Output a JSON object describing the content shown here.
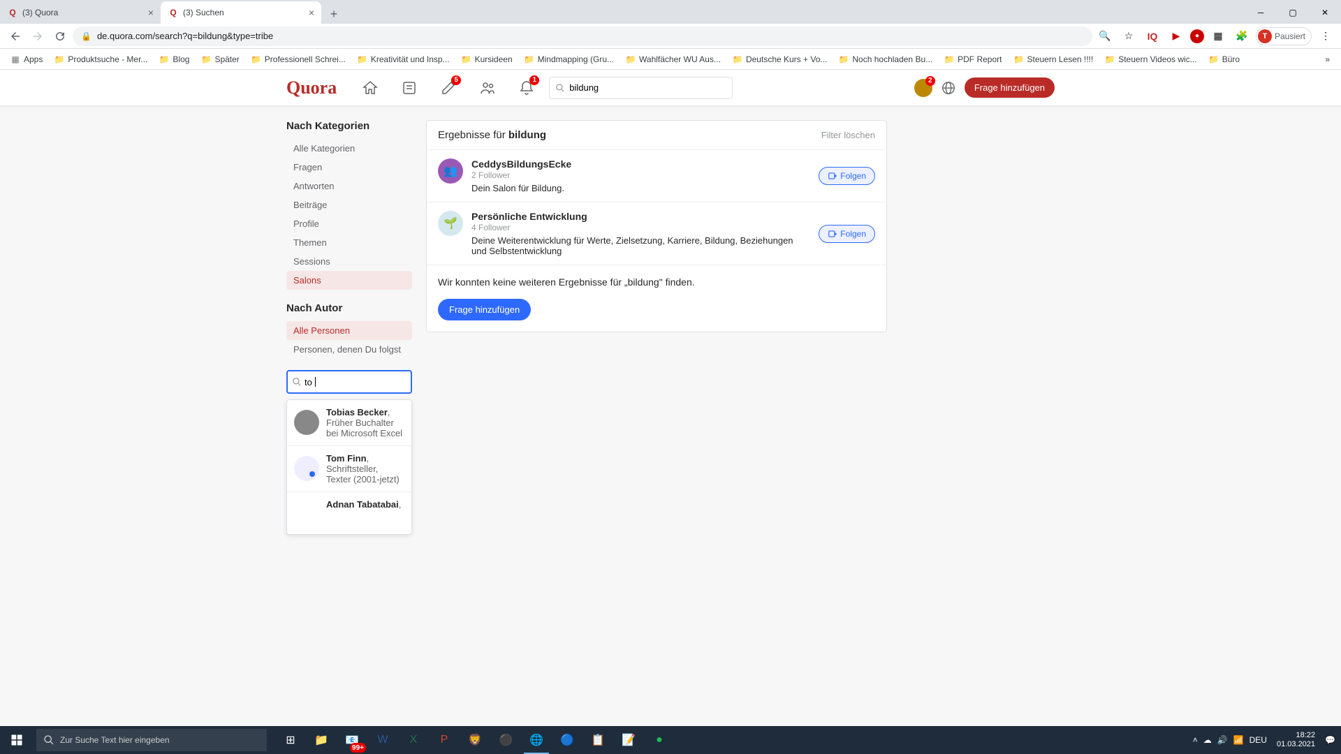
{
  "browser": {
    "tabs": [
      {
        "title": "(3) Quora",
        "active": false
      },
      {
        "title": "(3) Suchen",
        "active": true
      }
    ],
    "url": "de.quora.com/search?q=bildung&type=tribe",
    "profile_status": "Pausiert",
    "profile_initial": "T"
  },
  "bookmarks": [
    {
      "label": "Apps",
      "icon": "apps"
    },
    {
      "label": "Produktsuche - Mer...",
      "icon": "folder"
    },
    {
      "label": "Blog",
      "icon": "folder"
    },
    {
      "label": "Später",
      "icon": "folder"
    },
    {
      "label": "Professionell Schrei...",
      "icon": "folder"
    },
    {
      "label": "Kreativität und Insp...",
      "icon": "folder"
    },
    {
      "label": "Kursideen",
      "icon": "folder"
    },
    {
      "label": "Mindmapping (Gru...",
      "icon": "folder"
    },
    {
      "label": "Wahlfächer WU Aus...",
      "icon": "folder"
    },
    {
      "label": "Deutsche Kurs + Vo...",
      "icon": "folder"
    },
    {
      "label": "Noch hochladen Bu...",
      "icon": "folder"
    },
    {
      "label": "PDF Report",
      "icon": "folder"
    },
    {
      "label": "Steuern Lesen !!!!",
      "icon": "folder"
    },
    {
      "label": "Steuern Videos wic...",
      "icon": "folder"
    },
    {
      "label": "Büro",
      "icon": "folder"
    }
  ],
  "quora_header": {
    "logo": "Quora",
    "search_value": "bildung",
    "badges": {
      "edit": "5",
      "bell": "1",
      "profile": "2"
    },
    "add_question": "Frage hinzufügen"
  },
  "sidebar": {
    "categories_heading": "Nach Kategorien",
    "categories": [
      {
        "label": "Alle Kategorien",
        "active": false
      },
      {
        "label": "Fragen",
        "active": false
      },
      {
        "label": "Antworten",
        "active": false
      },
      {
        "label": "Beiträge",
        "active": false
      },
      {
        "label": "Profile",
        "active": false
      },
      {
        "label": "Themen",
        "active": false
      },
      {
        "label": "Sessions",
        "active": false
      },
      {
        "label": "Salons",
        "active": true
      }
    ],
    "author_heading": "Nach Autor",
    "persons": [
      {
        "label": "Alle Personen",
        "active": true
      },
      {
        "label": "Personen, denen Du folgst",
        "active": false
      }
    ],
    "person_search_value": "to",
    "autocomplete": [
      {
        "name": "Tobias Becker",
        "desc": "Früher Buchalter bei Microsoft Excel"
      },
      {
        "name": "Tom Finn",
        "desc": "Schriftsteller, Texter (2001-jetzt)"
      },
      {
        "name": "Adnan Tabatabai",
        "desc": ""
      }
    ]
  },
  "main": {
    "results_prefix": "Ergebnisse für ",
    "results_term": "bildung",
    "clear_filter": "Filter löschen",
    "follow_label": "Folgen",
    "results": [
      {
        "name": "CeddysBildungsEcke",
        "followers": "2 Follower",
        "desc": "Dein Salon für Bildung.",
        "color": "#9b59b6"
      },
      {
        "name": "Persönliche Entwicklung",
        "followers": "4 Follower",
        "desc": "Deine Weiterentwicklung für Werte, Zielsetzung, Karriere, Bildung, Beziehungen und Selbstentwicklung",
        "color": "#d4e8f0"
      }
    ],
    "no_more": "Wir konnten keine weiteren Ergebnisse für „bildung\" finden.",
    "add_question_btn": "Frage hinzufügen"
  },
  "taskbar": {
    "search_placeholder": "Zur Suche Text hier eingeben",
    "notif_count": "99+",
    "lang": "DEU",
    "time": "18:22",
    "date": "01.03.2021"
  }
}
